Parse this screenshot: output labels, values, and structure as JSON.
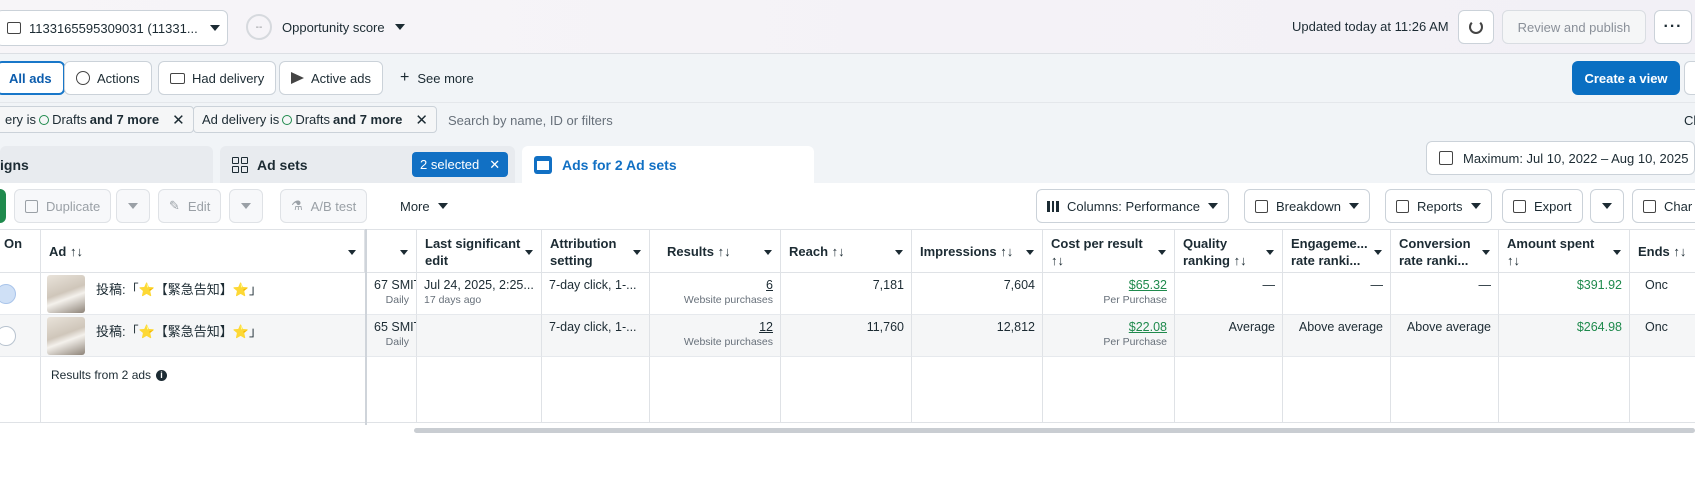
{
  "topbar": {
    "account_label": "1133165595309031 (11331...",
    "opportunity_label": "Opportunity score",
    "opportunity_ring": "--",
    "updated": "Updated today at 11:26 AM",
    "review_publish": "Review and publish",
    "more": "···"
  },
  "views": {
    "all_ads": "All ads",
    "actions": "Actions",
    "had_delivery": "Had delivery",
    "active_ads": "Active ads",
    "see_more": "See more",
    "create_view": "Create a view"
  },
  "filters": {
    "chip1_prefix": "ery is",
    "chip1_value": "Drafts",
    "chip1_more": "and 7 more",
    "chip2_prefix": "Ad delivery is",
    "chip2_value": "Drafts",
    "chip2_more": "and 7 more",
    "search_placeholder": "Search by name, ID or filters",
    "clear_edge": "Cl"
  },
  "tabs": {
    "campaigns": "igns",
    "adsets": "Ad sets",
    "selected": "2 selected",
    "ads": "Ads for 2 Ad sets",
    "date_range": "Maximum: Jul 10, 2022 – Aug 10, 2025"
  },
  "toolbar": {
    "duplicate": "Duplicate",
    "edit": "Edit",
    "ab_test": "A/B test",
    "more": "More",
    "columns": "Columns: Performance",
    "breakdown": "Breakdown",
    "reports": "Reports",
    "export": "Export",
    "charts": "Char"
  },
  "table": {
    "headers": {
      "on": "On",
      "ad": "Ad ↑↓",
      "last_edit_1": "Last significant",
      "last_edit_2": "edit",
      "attr_1": "Attribution",
      "attr_2": "setting",
      "results": "Results ↑↓",
      "reach": "Reach ↑↓",
      "impressions": "Impressions ↑↓",
      "cpr_1": "Cost per result",
      "cpr_2": "↑↓",
      "quality_1": "Quality",
      "quality_2": "ranking ↑↓",
      "engage_1": "Engageme...",
      "engage_2": "rate ranki...",
      "conv_1": "Conversion",
      "conv_2": "rate ranki...",
      "spent_1": "Amount spent",
      "spent_2": "↑↓",
      "ends": "Ends ↑↓"
    },
    "rows": [
      {
        "name": "投稿:「⭐【緊急告知】⭐」",
        "budget": "67 SMIT",
        "budget_sub": "Daily",
        "last_edit": "Jul 24, 2025, 2:25...",
        "last_edit_sub": "17 days ago",
        "attribution": "7-day click, 1-...",
        "results": "6",
        "results_sub": "Website purchases",
        "reach": "7,181",
        "impressions": "7,604",
        "cpr": "$65.32",
        "cpr_sub": "Per Purchase",
        "quality": "—",
        "engagement": "—",
        "conversion": "—",
        "spent": "$391.92",
        "ends": "Onc"
      },
      {
        "name": "投稿:「⭐【緊急告知】⭐」",
        "budget": "65 SMIT",
        "budget_sub": "Daily",
        "last_edit": "",
        "last_edit_sub": "",
        "attribution": "7-day click, 1-...",
        "results": "12",
        "results_sub": "Website purchases",
        "reach": "11,760",
        "impressions": "12,812",
        "cpr": "$22.08",
        "cpr_sub": "Per Purchase",
        "quality": "Average",
        "engagement": "Above average",
        "conversion": "Above average",
        "spent": "$264.98",
        "ends": "Onc"
      }
    ],
    "footer": "Results from 2 ads"
  }
}
